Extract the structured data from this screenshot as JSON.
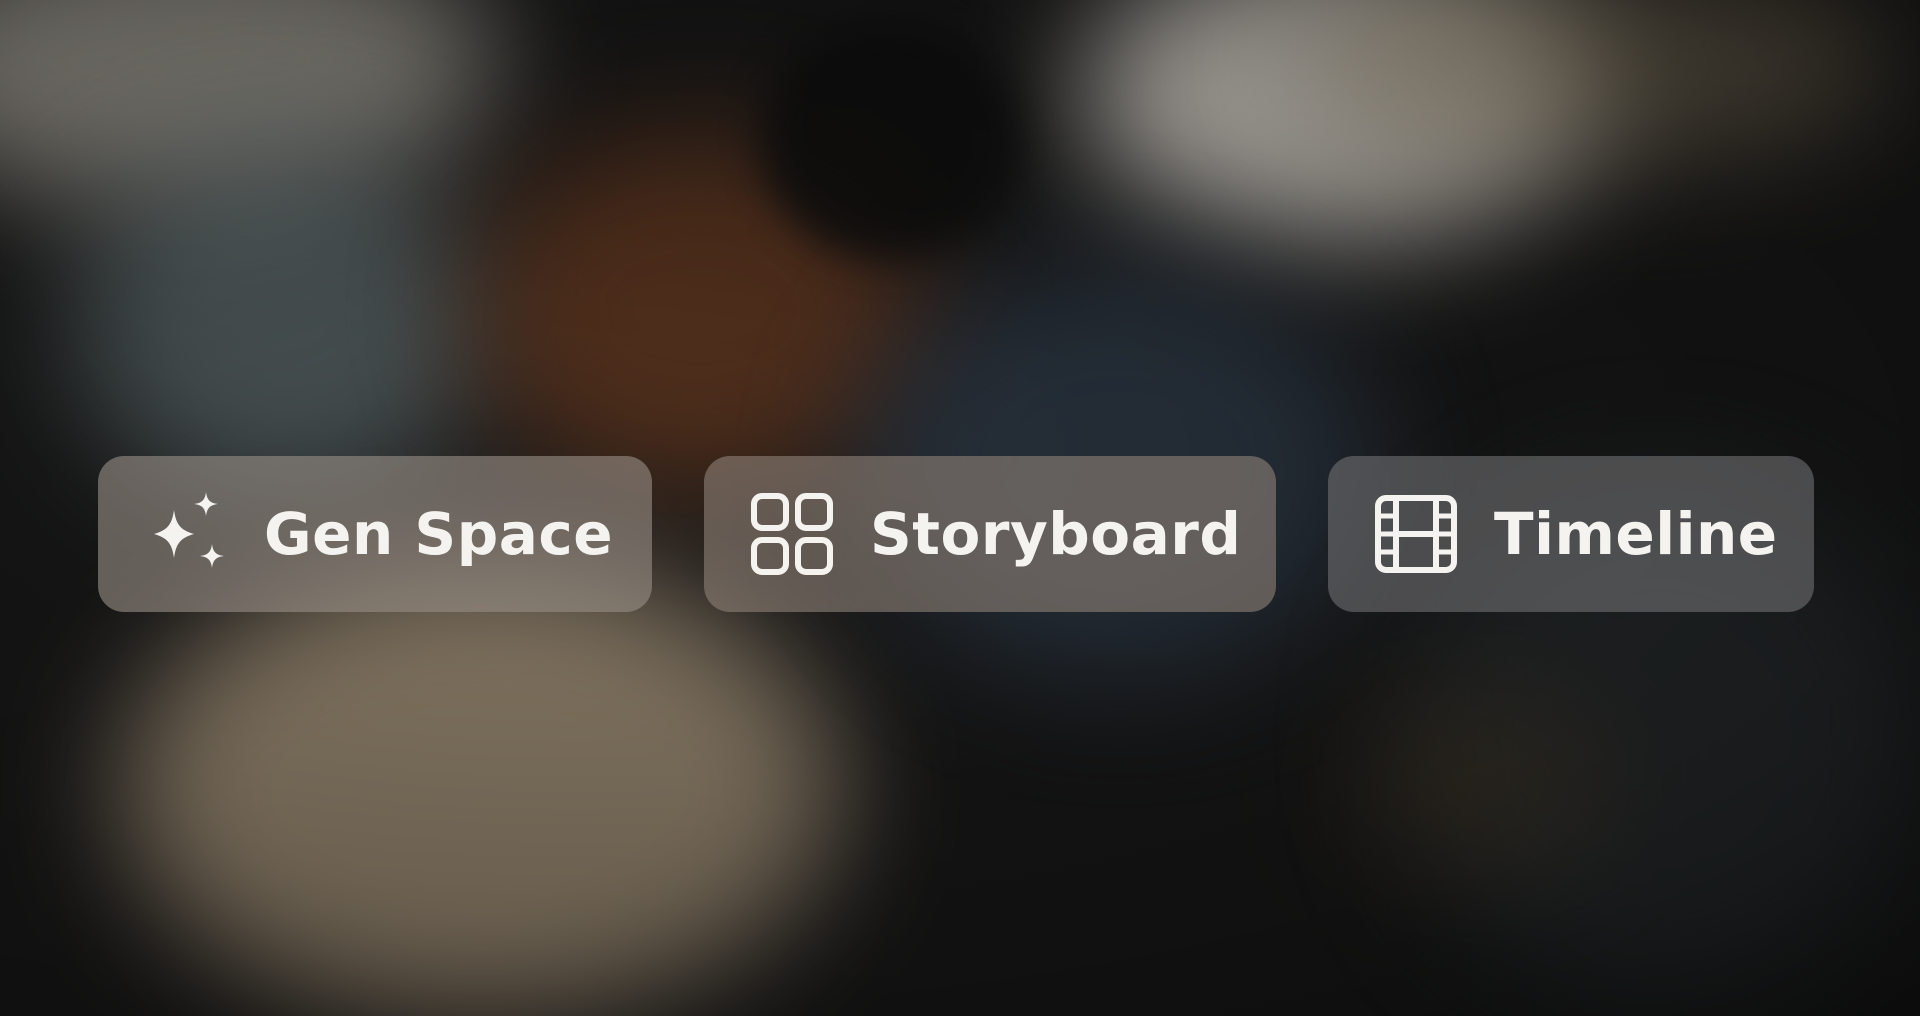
{
  "toolbar": {
    "buttons": [
      {
        "label": "Gen Space",
        "icon": "sparkles-icon"
      },
      {
        "label": "Storyboard",
        "icon": "grid-icon"
      },
      {
        "label": "Timeline",
        "icon": "film-icon"
      }
    ]
  },
  "colors": {
    "label_text": "#f5f3f0",
    "button_background": "#968c84"
  }
}
